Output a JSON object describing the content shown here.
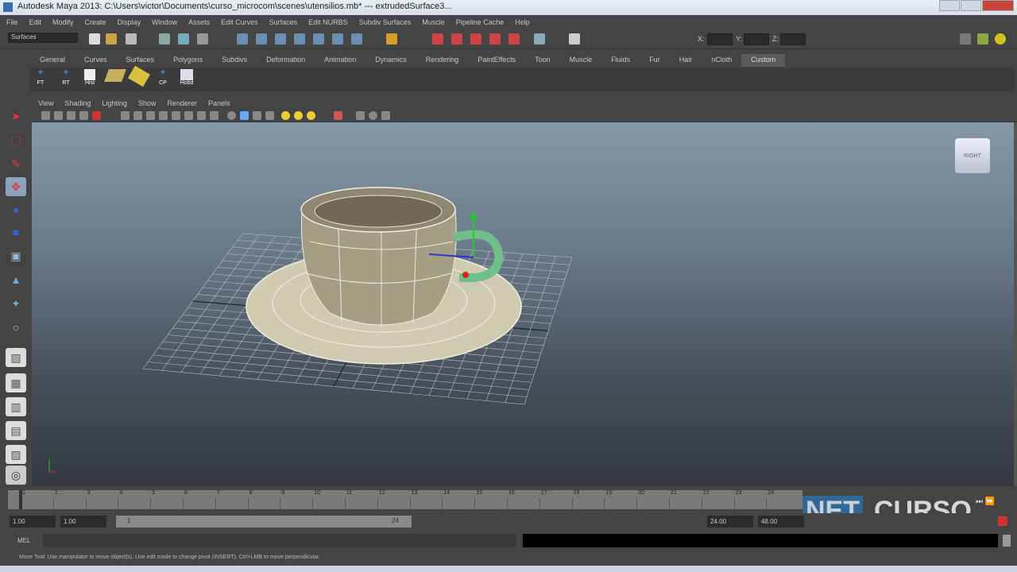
{
  "window": {
    "title": "Autodesk Maya 2013: C:\\Users\\victor\\Documents\\curso_microcom\\scenes\\utensilios.mb*   ---   extrudedSurface3..."
  },
  "menu": [
    "File",
    "Edit",
    "Modify",
    "Create",
    "Display",
    "Window",
    "Assets",
    "Edit Curves",
    "Surfaces",
    "Edit NURBS",
    "Subdiv Surfaces",
    "Muscle",
    "Pipeline Cache",
    "Help"
  ],
  "status": {
    "mode": "Surfaces",
    "x_label": "X:",
    "y_label": "Y:",
    "z_label": "Z:"
  },
  "shelf_tabs": [
    "General",
    "Curves",
    "Surfaces",
    "Polygons",
    "Subdivs",
    "Deformation",
    "Animation",
    "Dynamics",
    "Rendering",
    "PaintEffects",
    "Toon",
    "Muscle",
    "Fluids",
    "Fur",
    "Hair",
    "nCloth",
    "Custom"
  ],
  "active_shelf_tab": "Custom",
  "shelf_items": [
    "FT",
    "RT",
    "Hist",
    "",
    "",
    "CP",
    "Hobd"
  ],
  "panel_menu": [
    "View",
    "Shading",
    "Lighting",
    "Show",
    "Renderer",
    "Panels"
  ],
  "viewcube": {
    "label": "RIGHT"
  },
  "timeline": {
    "ticks": [
      "1",
      "2",
      "3",
      "4",
      "5",
      "6",
      "7",
      "8",
      "9",
      "10",
      "11",
      "12",
      "13",
      "14",
      "15",
      "16",
      "17",
      "18",
      "19",
      "20",
      "21",
      "22",
      "23",
      "24"
    ]
  },
  "range": {
    "start_time": "1.00",
    "start_range": "1.00",
    "slider_start": "1",
    "slider_end": "24",
    "end_range": "24.00",
    "end_time": "48.00"
  },
  "command": {
    "label": "MEL"
  },
  "help_line": "Move Tool: Use manipulator to move object(s). Use edit mode to change pivot (INSERT). Ctrl+LMB to move perpendicular.",
  "watermark": {
    "net": "NET",
    "curso": "CURSO"
  }
}
